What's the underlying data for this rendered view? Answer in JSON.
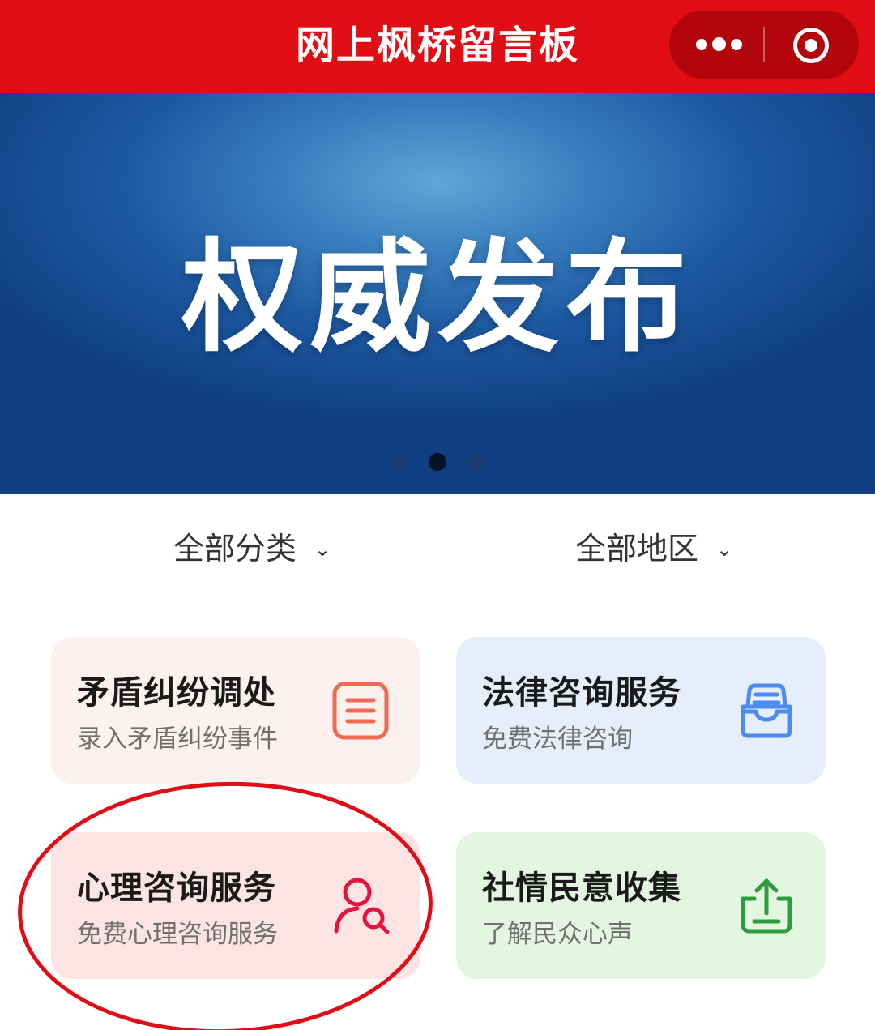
{
  "header": {
    "title": "网上枫桥留言板",
    "more_icon": "more-dots-icon",
    "close_icon": "target-circle-icon"
  },
  "banner": {
    "text": "权威发布",
    "slides_total": 3,
    "active_slide": 2
  },
  "filters": {
    "category_label": "全部分类",
    "region_label": "全部地区",
    "chevron": "⌄"
  },
  "cards": [
    {
      "title": "矛盾纠纷调处",
      "subtitle": "录入矛盾纠纷事件",
      "icon": "document-list-icon",
      "color": "#ef6a50"
    },
    {
      "title": "法律咨询服务",
      "subtitle": "免费法律咨询",
      "icon": "inbox-tray-icon",
      "color": "#4d8bf0"
    },
    {
      "title": "心理咨询服务",
      "subtitle": "免费心理咨询服务",
      "icon": "user-search-icon",
      "color": "#e8123c"
    },
    {
      "title": "社情民意收集",
      "subtitle": "了解民众心声",
      "icon": "upload-tray-icon",
      "color": "#2b9d3c"
    }
  ],
  "colors": {
    "header_red": "#e00d14",
    "annotation_red": "#e10d16"
  }
}
